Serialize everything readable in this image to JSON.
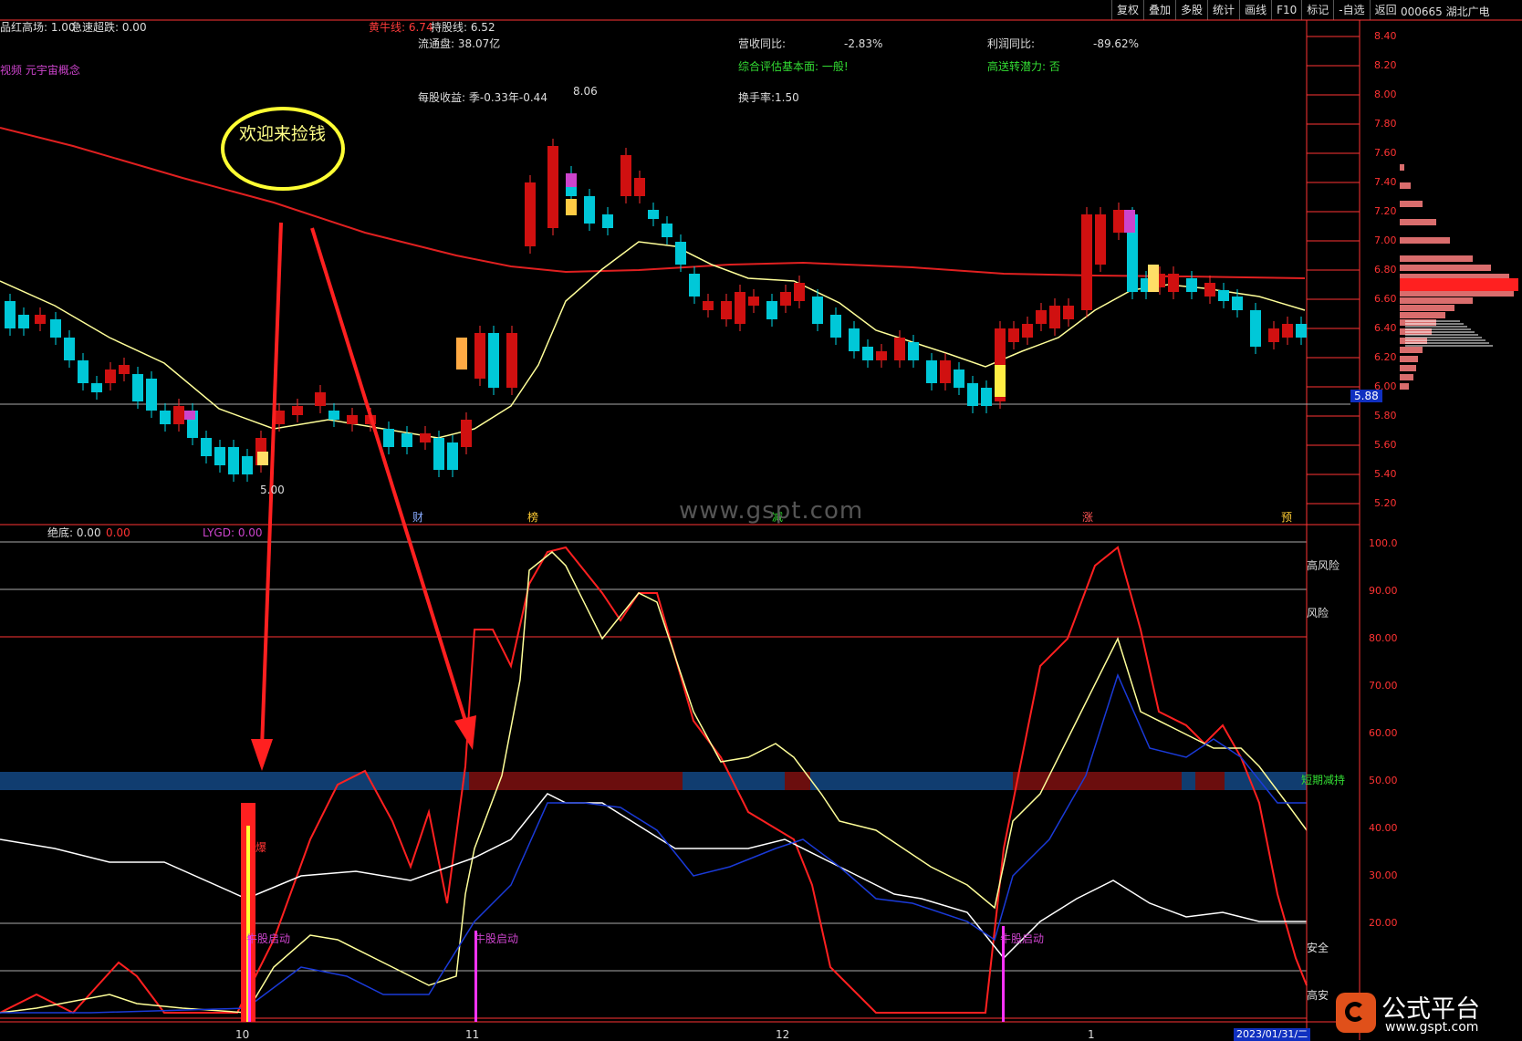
{
  "topbar": {
    "buttons": [
      "复权",
      "叠加",
      "多股",
      "统计",
      "画线",
      "F10",
      "标记",
      "-自选",
      "返回"
    ],
    "stock": "000665 湖北广电"
  },
  "header": {
    "line1": [
      {
        "label": "品红高场: 1.00",
        "color": "#ddd"
      },
      {
        "label": "急速超跌: 0.00",
        "color": "#ddd"
      },
      {
        "label": "黄牛线: 6.74",
        "color": "#ff3b3b"
      },
      {
        "label": "持股线: 6.52",
        "color": "#ddd"
      }
    ],
    "concept": "视频 元宇宙概念",
    "float_cap": "流通盘: 38.07亿",
    "rev_yoy_label": "营收同比:",
    "rev_yoy": "-2.83%",
    "profit_yoy_label": "利润同比:",
    "profit_yoy": "-89.62%",
    "eval": "综合评估基本面: 一般!",
    "transfer": "高送转潜力: 否",
    "eps": "每股收益: 季-0.33年-0.44",
    "turnover": "换手率:1.50"
  },
  "annotations": {
    "welcome": "欢迎来捡钱",
    "price_hi": "8.06",
    "price_lo": "5.00",
    "current": "5.88"
  },
  "price_axis": [
    "8.40",
    "8.20",
    "8.00",
    "7.80",
    "7.60",
    "7.40",
    "7.20",
    "7.00",
    "6.80",
    "6.60",
    "6.40",
    "6.20",
    "6.00",
    "5.80",
    "5.60",
    "5.40",
    "5.20"
  ],
  "event_markers": [
    "财",
    "榜",
    "减",
    "涨",
    "预"
  ],
  "watermark": "www.gspt.com",
  "indicator": {
    "label1": "绝底: 0.00",
    "label2": "0.00",
    "label3": "LYGD: 0.00",
    "axis": [
      "100.0",
      "90.00",
      "80.00",
      "70.00",
      "60.00",
      "50.00",
      "40.00",
      "30.00",
      "20.00"
    ],
    "zones": [
      "高风险",
      "风险",
      "短期减持",
      "安全",
      "高安"
    ],
    "signals": [
      "牛股启动",
      "牛股启动",
      "牛股启动"
    ],
    "burst": "爆"
  },
  "x_axis": [
    "10",
    "11",
    "12",
    "1"
  ],
  "date": "2023/01/31/二",
  "logo": {
    "text": "公式平台",
    "url": "www.gspt.com"
  },
  "colors": {
    "up": "#ff2020",
    "down": "#00d8e8",
    "ma": "#ffff99",
    "longma": "#e02020",
    "bg": "#000000",
    "grid": "#ff3333"
  }
}
